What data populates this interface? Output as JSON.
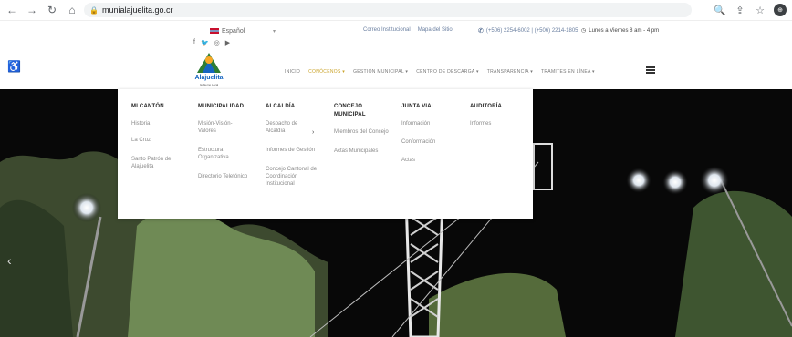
{
  "browser": {
    "url": "munialajuelita.go.cr",
    "back_icon": "arrow-left-icon",
    "forward_icon": "arrow-right-icon",
    "reload_icon": "reload-icon",
    "home_icon": "home-icon",
    "lock_icon": "lock-icon",
    "profile_letter": "⊕"
  },
  "topbar": {
    "language": "Español",
    "social": [
      "f",
      "🐦",
      "◎",
      "▶"
    ],
    "links": [
      "Correo Institucional",
      "Mapa del Sitio"
    ],
    "phone": "(+506) 2254-6002 | (+506) 2214-1805",
    "hours": "Lunes a Viernes 8 am - 4 pm"
  },
  "logo": {
    "name": "Alajuelita",
    "subtitle": "Gobierno Local"
  },
  "menu": [
    "INICIO",
    "CONÓCENOS ▾",
    "GESTIÓN MUNICIPAL ▾",
    "CENTRO DE DESCARGA ▾",
    "TRANSPARENCIA ▾",
    "TRAMITES EN LÍNEA ▾"
  ],
  "dropdown": {
    "columns": [
      {
        "title": "MI CANTÓN",
        "items": [
          "Historia",
          "La Cruz",
          "Santo Patrón de Alajuelita"
        ]
      },
      {
        "title": "MUNICIPALIDAD",
        "items": [
          "Misión-Visión-Valores",
          "Estructura Organizativa",
          "Directorio Telefónico"
        ]
      },
      {
        "title": "ALCALDÍA",
        "items": [
          "Despacho de Alcaldía",
          "Informes de Gestión",
          "Concejo Cantonal de Coordinación Institucional"
        ]
      },
      {
        "title": "CONCEJO MUNICIPAL",
        "items": [
          "Miembros del Concejo",
          "Actas Municipales"
        ]
      },
      {
        "title": "JUNTA VIAL",
        "items": [
          "Información",
          "Conformación",
          "Actas"
        ]
      },
      {
        "title": "AUDITORÍA",
        "items": [
          "Informes"
        ]
      }
    ]
  },
  "colors": {
    "accent": "#c9a227",
    "brand_blue": "#1565c0",
    "brand_green": "#2e7d32"
  }
}
